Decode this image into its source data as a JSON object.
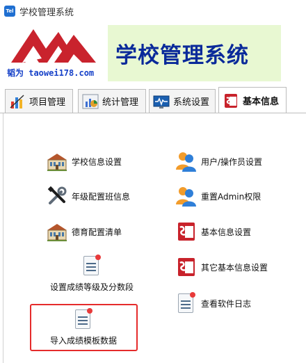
{
  "window": {
    "icon_text": "Tel",
    "title": "学校管理系统"
  },
  "banner": {
    "logo_url": "韬为 taowei178.com",
    "title": "学校管理系统"
  },
  "tabs": [
    {
      "label": "项目管理",
      "icon": "bar-chart-icon",
      "active": false
    },
    {
      "label": "统计管理",
      "icon": "stats-chart-icon",
      "active": false
    },
    {
      "label": "系统设置",
      "icon": "monitor-icon",
      "active": false
    },
    {
      "label": "基本信息",
      "icon": "office-icon",
      "active": true
    }
  ],
  "left_items": [
    {
      "label": "学校信息设置",
      "icon": "school-building-icon"
    },
    {
      "label": "年级配置班信息",
      "icon": "tools-icon"
    },
    {
      "label": "德育配置清单",
      "icon": "school-building-icon"
    },
    {
      "label": "设置成绩等级及分数段",
      "icon": "document-icon"
    },
    {
      "label": "导入成绩模板数据",
      "icon": "document-icon"
    }
  ],
  "right_items": [
    {
      "label": "用户/操作员设置",
      "icon": "users-icon"
    },
    {
      "label": "重置Admin权限",
      "icon": "users-icon"
    },
    {
      "label": "基本信息设置",
      "icon": "office-icon"
    },
    {
      "label": "其它基本信息设置",
      "icon": "office-icon"
    },
    {
      "label": "查看软件日志",
      "icon": "document-icon"
    }
  ],
  "colors": {
    "accent_red": "#e52b2b",
    "banner_bg": "#e8f8d2",
    "banner_title": "#0a2a9a",
    "logo_red": "#c9232d",
    "logo_url": "#1540c8"
  }
}
